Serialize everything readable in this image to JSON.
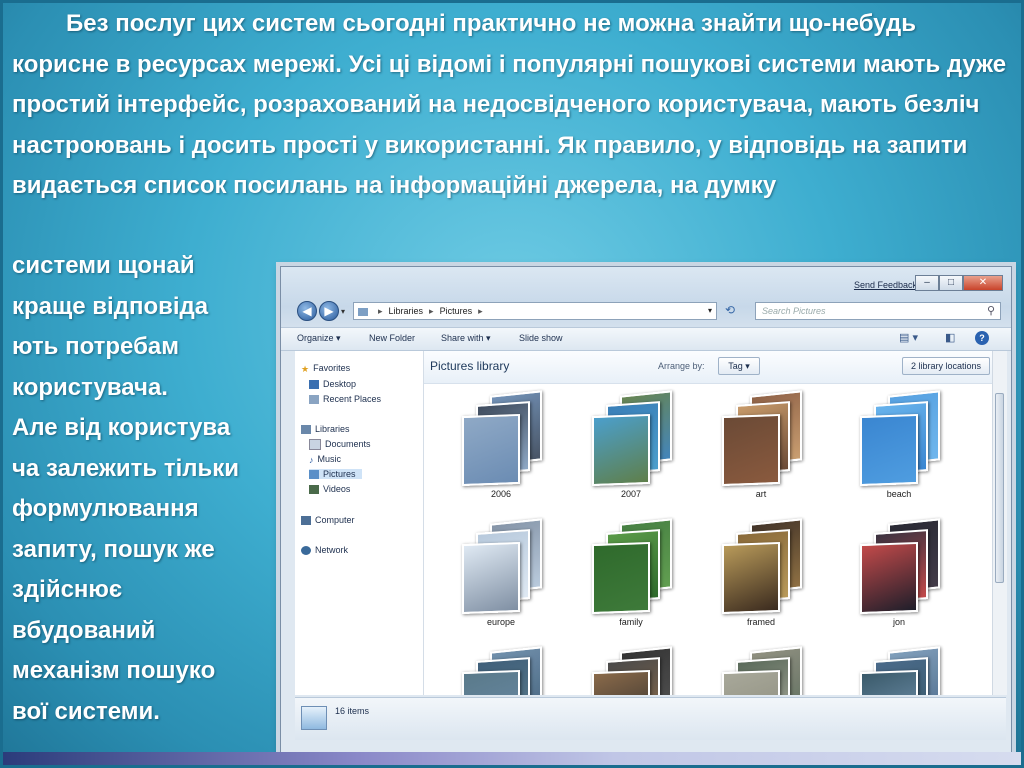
{
  "slide": {
    "paragraph_top": "Без послуг цих систем сьогодні практично не можна знайти що-небудь корисне в ресурсах мережі. Усі ці відомі і популярні пошукові системи мають дуже простий інтерфейс, розрахований на недосвідченого користувача, мають безліч настроювань і досить прості у використанні. Як правило, у відповідь на запити видається список посилань на інформаційні джерела, на думку",
    "left_lines": [
      "системи щонай",
      "краще відповіда",
      "ють потребам",
      "користувача.",
      "Але від користува",
      "ча залежить тільки",
      " формулювання",
      "запиту, пошук же",
      " здійснює",
      "вбудований",
      "механізм пошуко",
      "вої системи."
    ]
  },
  "explorer": {
    "send_feedback": "Send Feedback",
    "window_buttons": {
      "minimize": "–",
      "maximize": "□",
      "close": "✕"
    },
    "breadcrumb": [
      "Libraries",
      "Pictures"
    ],
    "search_placeholder": "Search Pictures",
    "toolbar": [
      "Organize ▾",
      "New Folder",
      "Share with ▾",
      "Slide show"
    ],
    "nav": {
      "favorites": "Favorites",
      "desktop": "Desktop",
      "recent_places": "Recent Places",
      "libraries": "Libraries",
      "documents": "Documents",
      "music": "Music",
      "pictures": "Pictures",
      "videos": "Videos",
      "computer": "Computer",
      "network": "Network"
    },
    "library_title": "Pictures library",
    "arrange_by_label": "Arrange by:",
    "arrange_by_value": "Tag ▾",
    "locations_button": "2 library locations",
    "folders": [
      {
        "name": "2006",
        "colors": [
          "#6b8cb3",
          "#3f4c5e",
          "#8fa9c6"
        ]
      },
      {
        "name": "2007",
        "colors": [
          "#5f7f4a",
          "#3a7fb8",
          "#4b9fcc"
        ]
      },
      {
        "name": "art",
        "colors": [
          "#8a5a3e",
          "#c79a6a",
          "#6b4a36"
        ]
      },
      {
        "name": "beach",
        "colors": [
          "#4f9de0",
          "#68b3ec",
          "#3a86d1"
        ]
      },
      {
        "name": "europe",
        "colors": [
          "#7f8fa3",
          "#b7c9dc",
          "#dfe9f3"
        ]
      },
      {
        "name": "family",
        "colors": [
          "#3e7a3a",
          "#5a9a48",
          "#2f6a2c"
        ]
      },
      {
        "name": "framed",
        "colors": [
          "#3a2a1e",
          "#8a6a3a",
          "#b89a5a"
        ]
      },
      {
        "name": "jon",
        "colors": [
          "#1e1e2a",
          "#3a3240",
          "#c24a4a"
        ]
      },
      {
        "name": "",
        "colors": [
          "#6a8aa8",
          "#3f5f7a",
          "#5a7a8a"
        ]
      },
      {
        "name": "",
        "colors": [
          "#2a2a2a",
          "#4a4a4a",
          "#8a6a4a"
        ]
      },
      {
        "name": "",
        "colors": [
          "#8a8a7a",
          "#5a6a5a",
          "#a8a89a"
        ]
      },
      {
        "name": "",
        "colors": [
          "#7a9ab8",
          "#4a6a8a",
          "#3a5a6a"
        ]
      }
    ],
    "status_text": "16 items"
  }
}
